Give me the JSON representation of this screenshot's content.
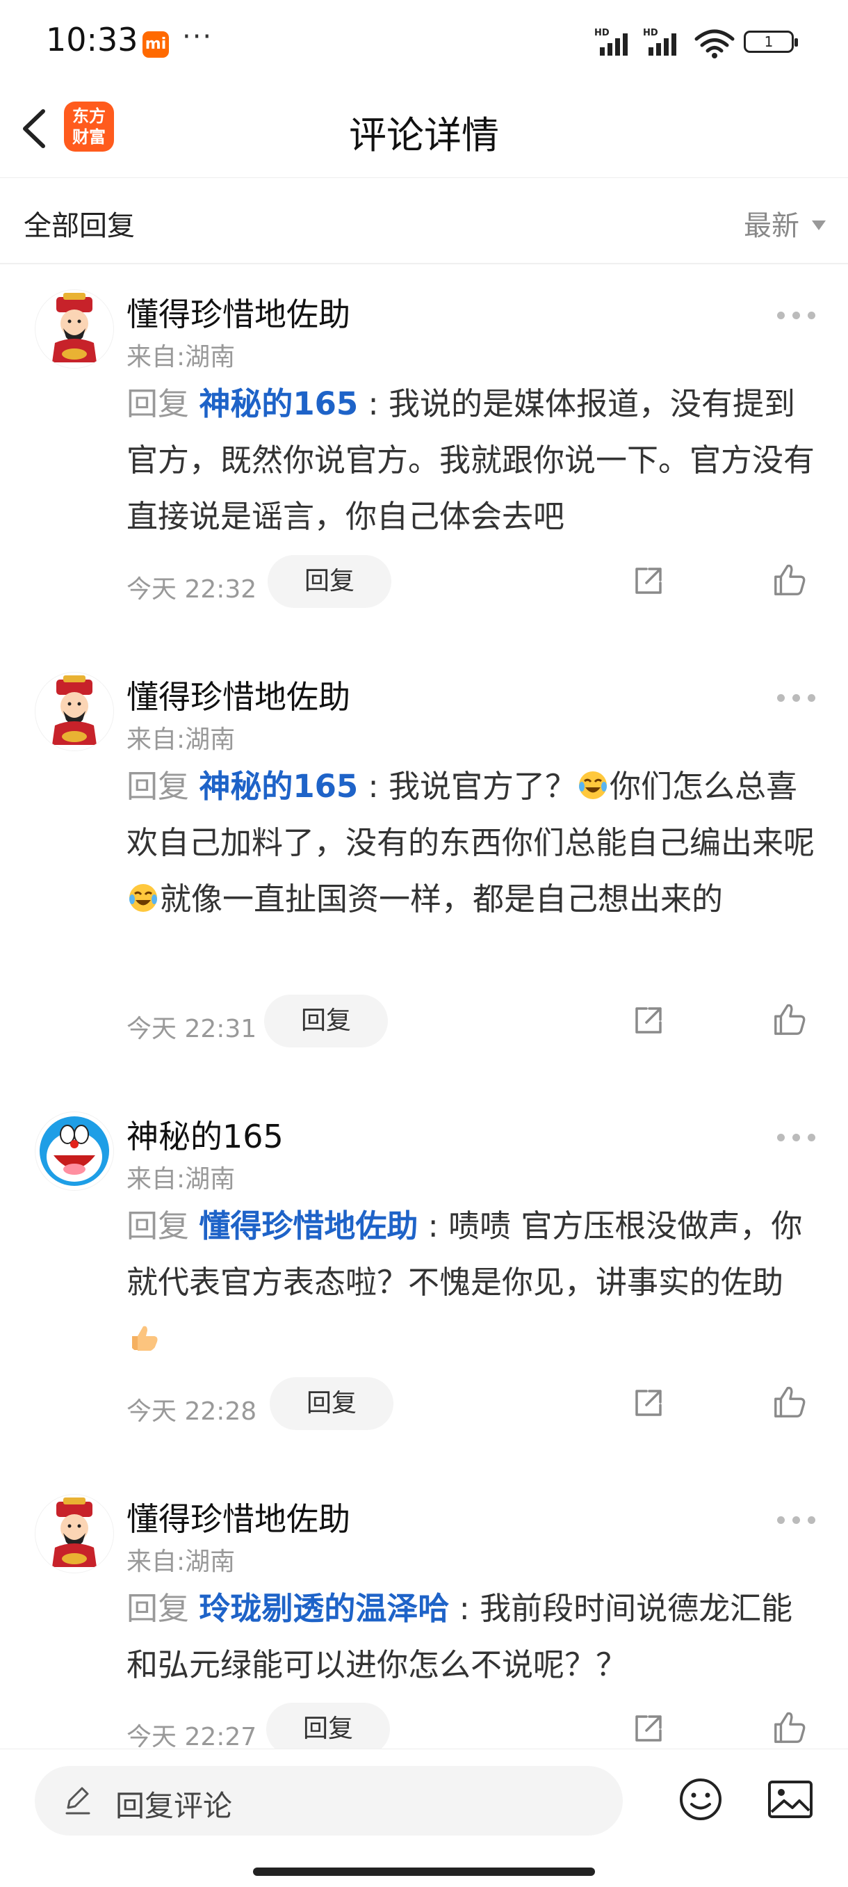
{
  "status_bar": {
    "time": "10:33",
    "mi_badge": "mi",
    "dots": "···",
    "battery": "1"
  },
  "header": {
    "title": "评论详情",
    "logo_text_top": "东方",
    "logo_text_bottom": "财富"
  },
  "filter": {
    "label": "全部回复",
    "sort": "最新"
  },
  "comments": [
    {
      "user": "懂得珍惜地佐助",
      "location": "来自:湖南",
      "prefix": "回复 ",
      "mention": "神秘的165",
      "text": " : 我说的是媒体报道，没有提到官方，既然你说官方。我就跟你说一下。官方没有直接说是谣言，你自己体会去吧",
      "time": "今天 22:32",
      "reply_label": "回复"
    },
    {
      "user": "懂得珍惜地佐助",
      "location": "来自:湖南",
      "prefix": "回复 ",
      "mention": "神秘的165",
      "text_a": " : 我说官方了？",
      "text_b": "你们怎么总喜欢自己加料了，没有的东西你们总能自己编出来呢",
      "text_c": "就像一直扯国资一样，都是自己想出来的",
      "time": "今天 22:31",
      "reply_label": "回复"
    },
    {
      "user": "神秘的165",
      "location": "来自:湖南",
      "prefix": "回复 ",
      "mention": "懂得珍惜地佐助",
      "text_a": " : 啧啧 官方压根没做声，你就代表官方表态啦？不愧是你见，讲事实的佐助",
      "time": "今天 22:28",
      "reply_label": "回复"
    },
    {
      "user": "懂得珍惜地佐助",
      "location": "来自:湖南",
      "prefix": "回复 ",
      "mention": "玲珑剔透的温泽哈",
      "text": " : 我前段时间说德龙汇能和弘元绿能可以进你怎么不说呢？？",
      "time": "今天 22:27",
      "reply_label": "回复"
    }
  ],
  "bottom_bar": {
    "placeholder": "回复评论"
  },
  "colors": {
    "mention": "#1e63c8",
    "brand": "#ff5b1d",
    "muted": "#999999"
  },
  "icons": [
    "back-icon",
    "share-icon",
    "like-icon",
    "more-icon",
    "pen-icon",
    "emoji-icon",
    "image-icon",
    "laugh-cry-emoji",
    "thumbs-up-emoji"
  ]
}
